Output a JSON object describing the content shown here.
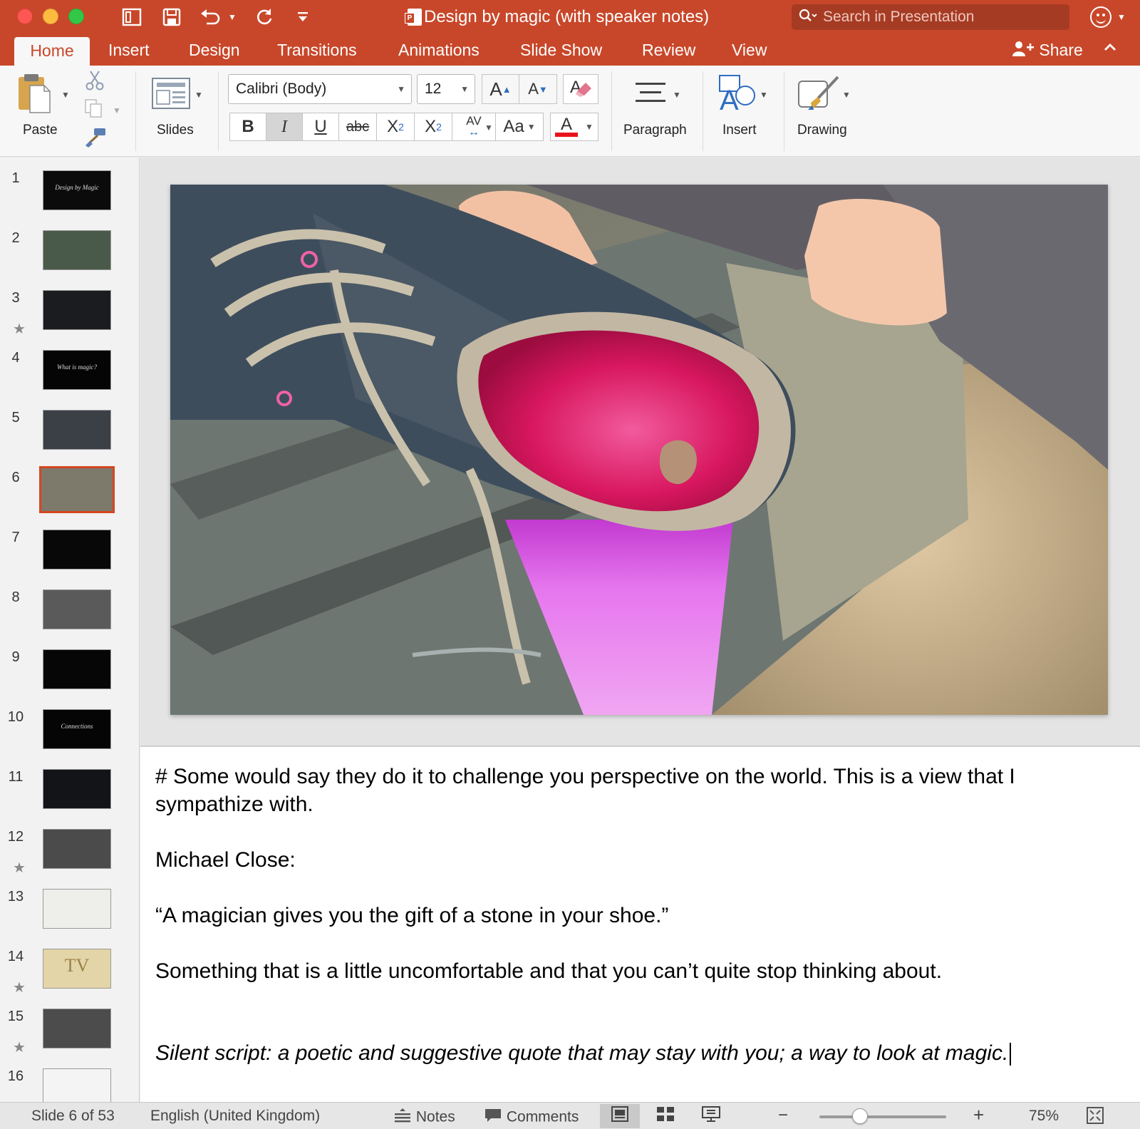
{
  "window": {
    "title": "Design by magic (with speaker notes)",
    "search_placeholder": "Search in Presentation"
  },
  "tabs": [
    {
      "label": "Home",
      "active": true
    },
    {
      "label": "Insert"
    },
    {
      "label": "Design"
    },
    {
      "label": "Transitions"
    },
    {
      "label": "Animations"
    },
    {
      "label": "Slide Show"
    },
    {
      "label": "Review"
    },
    {
      "label": "View"
    }
  ],
  "share_label": "Share",
  "ribbon": {
    "paste": "Paste",
    "slides": "Slides",
    "font_name": "Calibri (Body)",
    "font_size": "12",
    "paragraph": "Paragraph",
    "insert": "Insert",
    "drawing": "Drawing",
    "bold": "B",
    "italic": "I",
    "underline": "U",
    "strike": "abc",
    "superscript": "X",
    "sup_mark": "2",
    "subscript": "X",
    "sub_mark": "2",
    "spacing": "AV",
    "change_case": "Aa",
    "font_color_letter": "A",
    "grow_font": "A",
    "shrink_font": "A",
    "font_color": "#e8131b"
  },
  "slides": [
    {
      "num": "1",
      "caption": "Design by Magic",
      "bg": "#0b0b0b"
    },
    {
      "num": "2",
      "bg": "#4a5a4a"
    },
    {
      "num": "3",
      "star": "★",
      "bg": "#1a1c1f"
    },
    {
      "num": "4",
      "caption": "What is magic?",
      "bg": "#050505"
    },
    {
      "num": "5",
      "bg": "#3b4046"
    },
    {
      "num": "6",
      "bg": "#7d7a6c",
      "selected": true
    },
    {
      "num": "7",
      "bg": "#080808"
    },
    {
      "num": "8",
      "bg": "#5a5a5a"
    },
    {
      "num": "9",
      "bg": "#060606"
    },
    {
      "num": "10",
      "caption": "Connections",
      "bg": "#050505"
    },
    {
      "num": "11",
      "bg": "#121417"
    },
    {
      "num": "12",
      "star": "★",
      "bg": "#4b4b4b"
    },
    {
      "num": "13",
      "bg": "#eeeeea"
    },
    {
      "num": "14",
      "star": "★",
      "caption": "TV",
      "bg": "#e4d5a8"
    },
    {
      "num": "15",
      "star": "★",
      "bg": "#4c4c4c"
    },
    {
      "num": "16",
      "bg": "#f4f4f4"
    }
  ],
  "notes": {
    "line1": "# Some would say they do it to challenge you perspective on the world. This is a view that I sympathize with.",
    "line2": "Michael Close:",
    "line3": "“A magician gives you the gift of a stone in your shoe.”",
    "line4": "Something that is a little uncomfortable and that you can’t quite stop thinking about.",
    "line5": "Silent script: a poetic and suggestive quote that may stay with you; a way to look at magic."
  },
  "status": {
    "slide_info": "Slide 6 of 53",
    "language": "English (United Kingdom)",
    "notes_label": "Notes",
    "comments_label": "Comments",
    "zoom_minus": "−",
    "zoom_plus": "+",
    "zoom": "75%",
    "zoom_fraction": 0.32
  },
  "colors": {
    "accent": "#c8472a",
    "selection": "#d5471f"
  }
}
